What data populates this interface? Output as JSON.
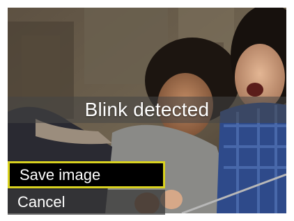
{
  "osd": {
    "message": "Blink detected"
  },
  "menu": {
    "items": [
      {
        "label": "Save image",
        "selected": true
      },
      {
        "label": "Cancel",
        "selected": false
      }
    ],
    "highlight_color": "#d9d21f"
  }
}
